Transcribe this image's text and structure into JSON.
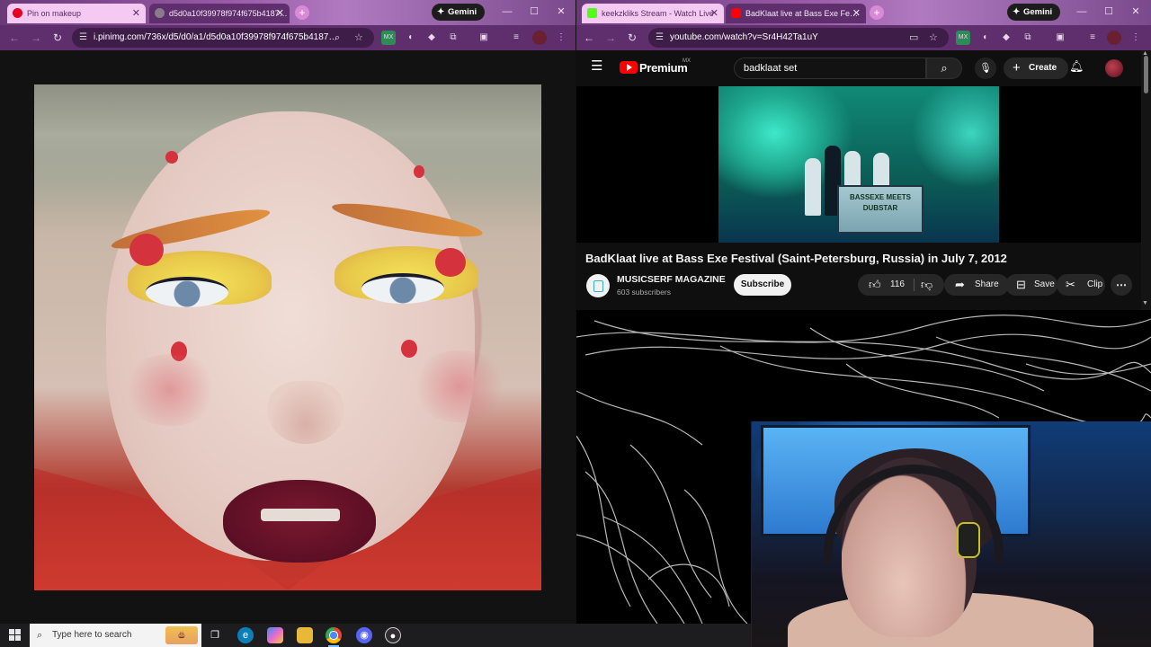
{
  "left_window": {
    "tabs": [
      {
        "label": "Pin on makeup",
        "state": "inactive"
      },
      {
        "label": "d5d0a10f39978f974f675b4187…",
        "state": "active"
      }
    ],
    "gemini_label": "Gemini",
    "url": "i.pinimg.com/736x/d5/d0/a1/d5d0a10f39978f974f675b4187…",
    "image_alt": "makeup photo"
  },
  "right_window": {
    "tabs": [
      {
        "label": "keekzkliks Stream - Watch Live",
        "state": "inactive"
      },
      {
        "label": "BadKlaat live at Bass Exe Fe…",
        "state": "active"
      }
    ],
    "gemini_label": "Gemini",
    "url": "youtube.com/watch?v=Sr4H42Ta1uY"
  },
  "youtube": {
    "brand": "Premium",
    "country": "MX",
    "search_value": "badklaat set",
    "create_label": "Create",
    "video": {
      "stage_banner": "BASSEXE MEETS DUBSTAR",
      "title": "BadKlaat live at Bass Exe Festival (Saint-Petersburg, Russia) in July 7, 2012",
      "channel": "MUSICSERF MAGAZINE",
      "subscribers": "603 subscribers",
      "subscribe_label": "Subscribe",
      "likes": "116",
      "share_label": "Share",
      "save_label": "Save",
      "clip_label": "Clip"
    }
  },
  "taskbar": {
    "search_placeholder": "Type here to search",
    "icons": [
      "task-view-icon",
      "edge-icon",
      "copilot-icon",
      "file-explorer-icon",
      "chrome-icon",
      "discord-icon",
      "obs-icon"
    ]
  },
  "colors": {
    "tab_strip": "#6a3a78",
    "toolbar": "#5e2f6c",
    "youtube_red": "#ff0000",
    "youtube_bg": "#0f0f0f"
  }
}
